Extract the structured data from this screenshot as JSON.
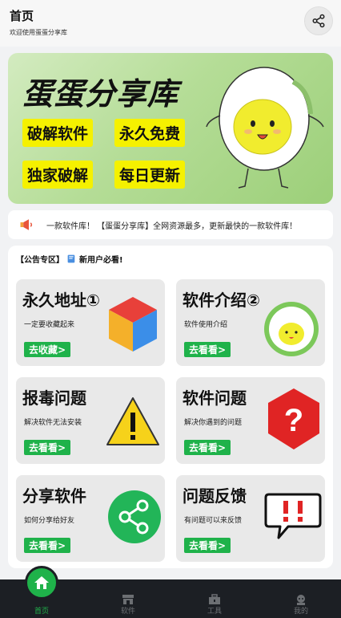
{
  "header": {
    "title": "首页",
    "subtitle": "欢迎使用蛋蛋分享库"
  },
  "banner": {
    "title": "蛋蛋分享库",
    "tags": [
      "破解软件",
      "永久免费",
      "独家破解",
      "每日更新"
    ]
  },
  "notice": {
    "text": "一款软件库！ 【蛋蛋分享库】全网资源最多，更新最快的一款软件库！"
  },
  "announcement": {
    "prefix": "【公告专区】",
    "highlight": "新用户必看!"
  },
  "cards": [
    {
      "title": "永久地址①",
      "desc": "一定要收藏起来",
      "button": "去收藏>"
    },
    {
      "title": "软件介绍②",
      "desc": "软件使用介绍",
      "button": "去看看>"
    },
    {
      "title": "报毒问题",
      "desc": "解决软件无法安装",
      "button": "去看看>"
    },
    {
      "title": "软件问题",
      "desc": "解决你遇到的问题",
      "button": "去看看>"
    },
    {
      "title": "分享软件",
      "desc": "如何分享给好友",
      "button": "去看看>"
    },
    {
      "title": "问题反馈",
      "desc": "有问题可以来反馈",
      "button": "去看看>"
    }
  ],
  "tabbar": {
    "items": [
      {
        "label": "首页",
        "icon": "home-icon",
        "active": true
      },
      {
        "label": "软件",
        "icon": "store-icon",
        "active": false
      },
      {
        "label": "工具",
        "icon": "toolbox-icon",
        "active": false
      },
      {
        "label": "我的",
        "icon": "user-icon",
        "active": false
      }
    ]
  },
  "colors": {
    "accent": "#1fb24a",
    "tag_yellow": "#f5f100",
    "tabbar_bg": "#1c1f24"
  }
}
